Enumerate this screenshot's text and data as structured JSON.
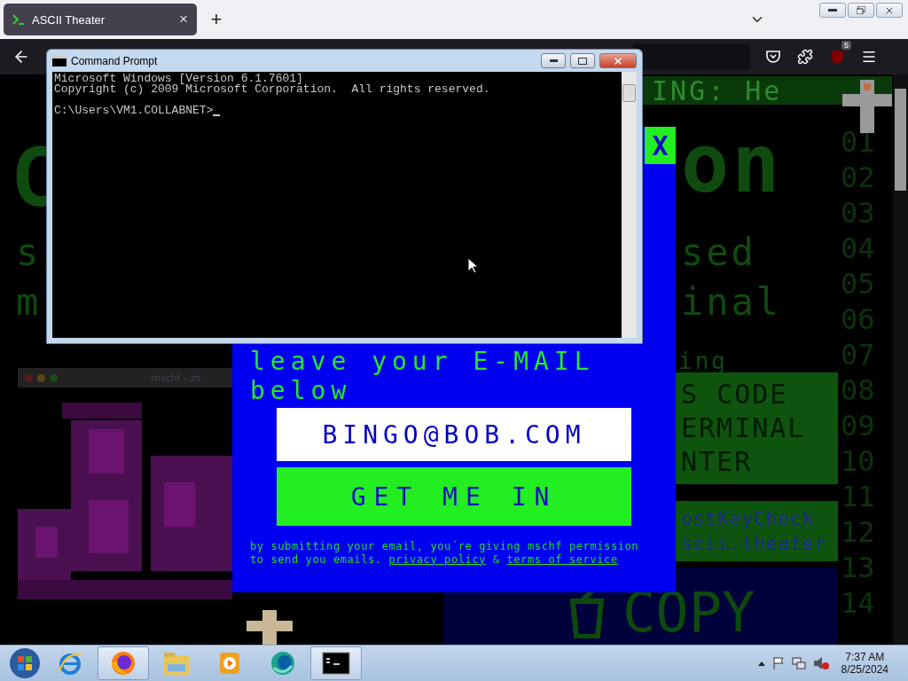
{
  "browser": {
    "tabs": [
      {
        "title": "ASCII Theater",
        "close": "×",
        "selected": true
      }
    ],
    "new_tab": "+",
    "extension_badge": "5"
  },
  "page": {
    "fragments": [
      {
        "text": "ING: He",
        "kind": "band"
      },
      {
        "text": "C",
        "kind": "huge"
      },
      {
        "text": "on",
        "kind": "huge"
      },
      {
        "text": "s",
        "kind": "large"
      },
      {
        "text": "m",
        "kind": "large"
      },
      {
        "text": "sed",
        "kind": "large"
      },
      {
        "text": "inal",
        "kind": "large"
      },
      {
        "text": "ing",
        "kind": "small"
      }
    ],
    "line_numbers": [
      "01",
      "02",
      "03",
      "04",
      "05",
      "06",
      "07",
      "08",
      "09",
      "10",
      "11",
      "12",
      "13",
      "14"
    ],
    "panels": [
      {
        "kind": "code",
        "lines": [
          "S CODE",
          "ERMINAL",
          "NTER"
        ]
      },
      {
        "kind": "command",
        "lines": [
          "ostKeyCheck",
          "scii.theater"
        ]
      }
    ],
    "copy_label": "COPY",
    "inner_window": {
      "title": "mschf --zs"
    }
  },
  "signup_modal": {
    "close": "X",
    "heading_lines": [
      "leave your E-MAIL",
      "below"
    ],
    "email_value": "BINGO@BOB.COM",
    "submit": "GET ME IN",
    "disclaimer": [
      {
        "kind": "text",
        "text": "by submitting your email, you´re giving mschf permission to send you emails. "
      },
      {
        "kind": "link",
        "text": "privacy policy"
      },
      {
        "kind": "text",
        "text": " & "
      },
      {
        "kind": "link",
        "text": "terms of service"
      }
    ]
  },
  "cmd_window": {
    "title": "Command Prompt",
    "lines": [
      "Microsoft Windows [Version 6.1.7601]",
      "Copyright (c) 2009 Microsoft Corporation.  All rights reserved."
    ],
    "prompt": "C:\\Users\\VM1.COLLABNET>"
  },
  "taskbar": {
    "apps": [
      {
        "kind": "ie",
        "selected": false
      },
      {
        "kind": "firefox",
        "selected": true
      },
      {
        "kind": "explorer",
        "selected": false
      },
      {
        "kind": "media",
        "selected": false
      },
      {
        "kind": "teams",
        "selected": false
      },
      {
        "kind": "cmd",
        "selected": true
      }
    ],
    "time": "7:37 AM",
    "date": "8/25/2024"
  }
}
